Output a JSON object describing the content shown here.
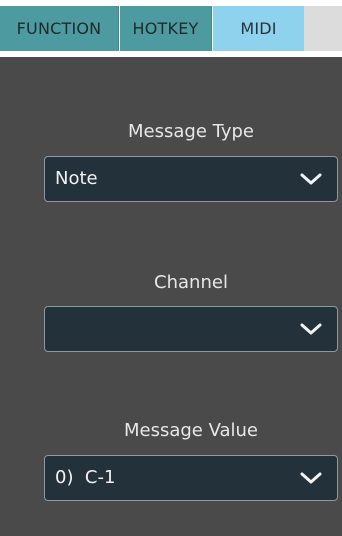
{
  "tabs": [
    {
      "label": "FUNCTION",
      "active": false
    },
    {
      "label": "HOTKEY",
      "active": false
    },
    {
      "label": "MIDI",
      "active": true
    }
  ],
  "fields": {
    "message_type": {
      "label": "Message Type",
      "value": "Note",
      "icon": "chevron-down-icon"
    },
    "channel": {
      "label": "Channel",
      "value": "",
      "icon": "chevron-down-icon"
    },
    "message_value": {
      "label": "Message Value",
      "value": "0)  C-1",
      "icon": "chevron-down-icon"
    }
  },
  "colors": {
    "tab_inactive": "#4d9aa0",
    "tab_active": "#8fd2ee",
    "panel_bg": "#4a4a4a",
    "dropdown_bg": "#23313b"
  }
}
